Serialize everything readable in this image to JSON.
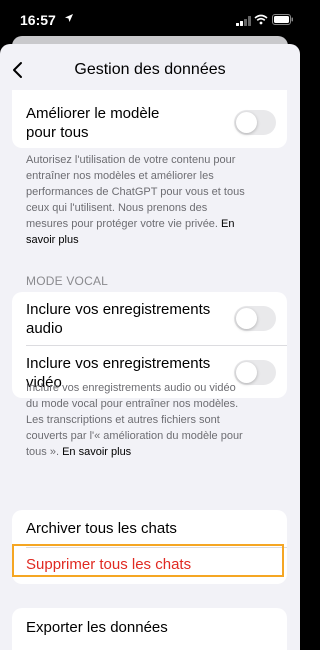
{
  "status_bar": {
    "time": "16:57",
    "icons": [
      "location-arrow-icon",
      "signal-icon",
      "wifi-icon",
      "battery-icon"
    ]
  },
  "nav": {
    "title": "Gestion des données",
    "back_icon": "chevron-left-icon"
  },
  "improve_model": {
    "label_line1": "Améliorer le modèle",
    "label_line2": "pour tous",
    "enabled": false,
    "footnote_lines": [
      "Autorisez l'utilisation de votre contenu pour",
      "entraîner nos modèles et améliorer les",
      "performances de ChatGPT pour vous et tous",
      "ceux qui l'utilisent. Nous prenons des",
      "mesures pour protéger votre vie privée."
    ],
    "footnote_link_part1": "En",
    "footnote_link_part2": "savoir plus"
  },
  "voice_mode": {
    "section_header": "MODE VOCAL",
    "audio_line1": "Inclure vos enregistrements",
    "audio_line2": "audio",
    "audio_enabled": false,
    "video_line1": "Inclure vos enregistrements",
    "video_line2": "vidéo",
    "video_enabled": false,
    "footnote_lines": [
      "Inclure vos enregistrements audio ou vidéo",
      "du mode vocal pour entraîner nos modèles.",
      "Les transcriptions et autres fichiers sont",
      "couverts par l'« amélioration du modèle pour"
    ],
    "footnote_last_line": "tous ».",
    "footnote_link": "En savoir plus"
  },
  "chats": {
    "archive_label": "Archiver tous les chats",
    "delete_label": "Supprimer tous les chats"
  },
  "export": {
    "label": "Exporter les données"
  },
  "colors": {
    "danger": "#e02a22",
    "highlight": "#f5a623",
    "background": "#f2f2f7"
  }
}
